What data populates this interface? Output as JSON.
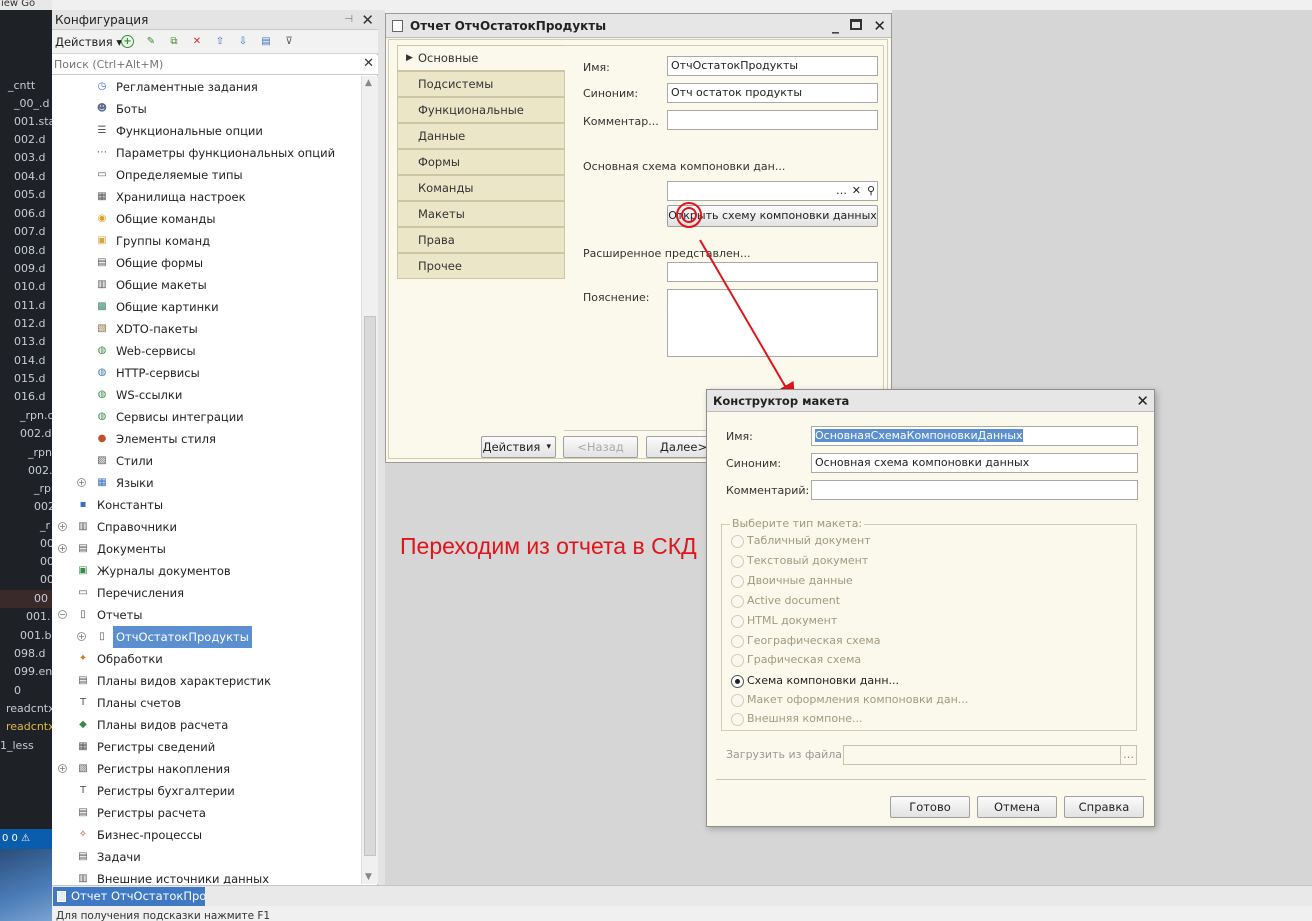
{
  "editor": {
    "menu": "iew  Go",
    "files": [
      "_cntt",
      "_00_.d",
      "001.sta",
      "002.d",
      "003.d",
      "004.d",
      "005.d",
      "006.d",
      "007.d",
      "008.d",
      "009.d",
      "010.d",
      "011.d",
      "012.d",
      "013.d",
      "014.d",
      "015.d",
      "016.d",
      "_rpn.c",
      "002.d",
      "_rpn",
      "002.",
      "_rp",
      "002",
      "_r",
      "00",
      "00",
      "00",
      "00",
      "001.",
      "001.b",
      "098.d",
      "099.en",
      "0",
      "readcntx",
      "readcntx",
      "1_less"
    ],
    "status": "0  0 ⚠"
  },
  "config": {
    "title": "Конфигурация",
    "actions_label": "Действия",
    "search_placeholder": "Поиск (Ctrl+Alt+M)",
    "tree": [
      {
        "label": "Регламентные задания",
        "level": 1,
        "icon": "clock-icon"
      },
      {
        "label": "Боты",
        "level": 1,
        "icon": "bot-icon"
      },
      {
        "label": "Функциональные опции",
        "level": 1,
        "icon": "options-icon"
      },
      {
        "label": "Параметры функциональных опций",
        "level": 1,
        "icon": "params-icon"
      },
      {
        "label": "Определяемые типы",
        "level": 1,
        "icon": "types-icon"
      },
      {
        "label": "Хранилища настроек",
        "level": 1,
        "icon": "storage-icon"
      },
      {
        "label": "Общие команды",
        "level": 1,
        "icon": "command-icon"
      },
      {
        "label": "Группы команд",
        "level": 1,
        "icon": "folder-icon"
      },
      {
        "label": "Общие формы",
        "level": 1,
        "icon": "form-icon"
      },
      {
        "label": "Общие макеты",
        "level": 1,
        "icon": "layout-icon"
      },
      {
        "label": "Общие картинки",
        "level": 1,
        "icon": "picture-icon"
      },
      {
        "label": "XDTO-пакеты",
        "level": 1,
        "icon": "package-icon"
      },
      {
        "label": "Web-сервисы",
        "level": 1,
        "icon": "globe-icon"
      },
      {
        "label": "HTTP-сервисы",
        "level": 1,
        "icon": "http-icon"
      },
      {
        "label": "WS-ссылки",
        "level": 1,
        "icon": "globe-icon"
      },
      {
        "label": "Сервисы интеграции",
        "level": 1,
        "icon": "integration-icon"
      },
      {
        "label": "Элементы стиля",
        "level": 1,
        "icon": "style-element-icon"
      },
      {
        "label": "Стили",
        "level": 1,
        "icon": "style-icon"
      },
      {
        "label": "Языки",
        "level": 1,
        "icon": "language-icon",
        "expand": true
      },
      {
        "label": "Константы",
        "level": 0,
        "icon": "constant-icon"
      },
      {
        "label": "Справочники",
        "level": 0,
        "icon": "catalog-icon",
        "expand": true
      },
      {
        "label": "Документы",
        "level": 0,
        "icon": "document-icon",
        "expand": true
      },
      {
        "label": "Журналы документов",
        "level": 0,
        "icon": "journal-icon"
      },
      {
        "label": "Перечисления",
        "level": 0,
        "icon": "enum-icon"
      },
      {
        "label": "Отчеты",
        "level": 0,
        "icon": "report-icon",
        "expand": true,
        "collapsed_sign": "−"
      },
      {
        "label": "ОтчОстатокПродукты",
        "level": 1,
        "icon": "report-icon",
        "expand": true,
        "selected": true
      },
      {
        "label": "Обработки",
        "level": 0,
        "icon": "processing-icon"
      },
      {
        "label": "Планы видов характеристик",
        "level": 0,
        "icon": "chart-plan-icon"
      },
      {
        "label": "Планы счетов",
        "level": 0,
        "icon": "accounts-icon"
      },
      {
        "label": "Планы видов расчета",
        "level": 0,
        "icon": "calc-plan-icon"
      },
      {
        "label": "Регистры сведений",
        "level": 0,
        "icon": "info-register-icon"
      },
      {
        "label": "Регистры накопления",
        "level": 0,
        "icon": "accum-register-icon",
        "expand": true
      },
      {
        "label": "Регистры бухгалтерии",
        "level": 0,
        "icon": "acc-register-icon"
      },
      {
        "label": "Регистры расчета",
        "level": 0,
        "icon": "calc-register-icon"
      },
      {
        "label": "Бизнес-процессы",
        "level": 0,
        "icon": "bp-icon"
      },
      {
        "label": "Задачи",
        "level": 0,
        "icon": "task-icon"
      },
      {
        "label": "Внешние источники данных",
        "level": 0,
        "icon": "ext-source-icon"
      }
    ]
  },
  "report": {
    "title": "Отчет ОтчОстатокПродукты",
    "tabs": [
      "Основные",
      "Подсистемы",
      "Функциональные опции",
      "Данные",
      "Формы",
      "Команды",
      "Макеты",
      "Права",
      "Прочее"
    ],
    "name_label": "Имя:",
    "name_value": "ОтчОстатокПродукты",
    "synonym_label": "Синоним:",
    "synonym_value": "Отч остаток продукты",
    "comment_label": "Комментар...",
    "comment_value": "",
    "schema_label": "Основная схема компоновки дан...",
    "schema_value": "",
    "open_schema_button": "Открыть схему компоновки данных",
    "extended_label": "Расширенное представлен...",
    "note_label": "Пояснение:",
    "actions_button": "Действия",
    "back_button": "<Назад",
    "next_button": "Далее>"
  },
  "annotation": "Переходим из отчета в СКД",
  "dialog": {
    "title": "Конструктор макета",
    "name_label": "Имя:",
    "name_value": "ОсновнаяСхемаКомпоновкиДанных",
    "synonym_label": "Синоним:",
    "synonym_value": "Основная схема компоновки данных",
    "comment_label": "Комментарий:",
    "comment_value": "",
    "group_label": "Выберите тип макета:",
    "types": [
      "Табличный документ",
      "Текстовый документ",
      "Двоичные данные",
      "Active document",
      "HTML документ",
      "Географическая схема",
      "Графическая схема",
      "Схема компоновки данн...",
      "Макет оформления компоновки дан...",
      "Внешняя компоне..."
    ],
    "selected_type": 7,
    "load_label": "Загрузить из файла:",
    "ok_button": "Готово",
    "cancel_button": "Отмена",
    "help_button": "Справка"
  },
  "taskbar": {
    "item": "Отчет ОтчОстатокПро..."
  },
  "status": "Для получения подсказки нажмите F1",
  "colors": {
    "accent": "#e0141b",
    "selection": "#5b8fd0",
    "panel": "#fbf9ec"
  }
}
